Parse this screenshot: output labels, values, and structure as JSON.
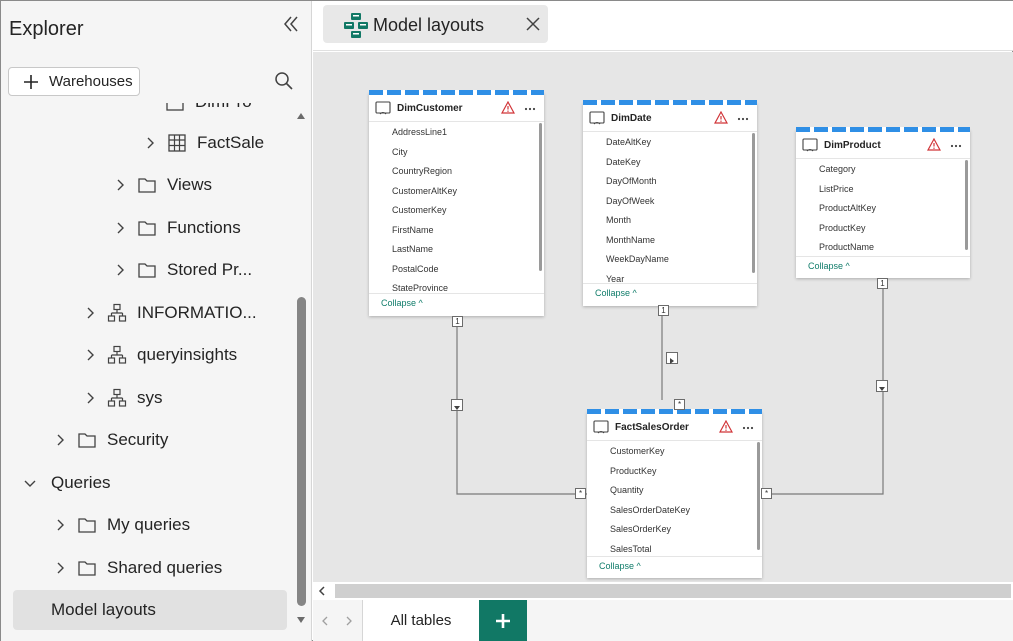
{
  "sidebar": {
    "title": "Explorer",
    "add_button_label": "Warehouses",
    "tree": {
      "partial_top": "DimPro",
      "fact_sale": "FactSale",
      "views": "Views",
      "functions": "Functions",
      "stored_procs": "Stored Pr...",
      "information_schema": "INFORMATIO...",
      "queryinsights": "queryinsights",
      "sys": "sys",
      "security": "Security",
      "queries": "Queries",
      "my_queries": "My queries",
      "shared_queries": "Shared queries",
      "model_layouts": "Model layouts"
    }
  },
  "tab": {
    "label": "Model layouts"
  },
  "tables": {
    "dimcustomer": {
      "name": "DimCustomer",
      "columns": [
        "AddressLine1",
        "City",
        "CountryRegion",
        "CustomerAltKey",
        "CustomerKey",
        "FirstName",
        "LastName",
        "PostalCode",
        "StateProvince"
      ],
      "collapse": "Collapse"
    },
    "dimdate": {
      "name": "DimDate",
      "columns": [
        "DateAltKey",
        "DateKey",
        "DayOfMonth",
        "DayOfWeek",
        "Month",
        "MonthName",
        "WeekDayName",
        "Year"
      ],
      "collapse": "Collapse"
    },
    "dimproduct": {
      "name": "DimProduct",
      "columns": [
        "Category",
        "ListPrice",
        "ProductAltKey",
        "ProductKey",
        "ProductName"
      ],
      "collapse": "Collapse"
    },
    "factsalesorder": {
      "name": "FactSalesOrder",
      "columns": [
        "CustomerKey",
        "ProductKey",
        "Quantity",
        "SalesOrderDateKey",
        "SalesOrderKey",
        "SalesTotal"
      ],
      "collapse": "Collapse"
    }
  },
  "relationships": {
    "one": "1",
    "many": "*"
  },
  "bottom": {
    "all_tables": "All tables"
  },
  "colors": {
    "accent_green": "#117865",
    "collapse_link": "#107c6a",
    "stripe_blue": "#2f8fe6",
    "warning": "#d13438"
  }
}
